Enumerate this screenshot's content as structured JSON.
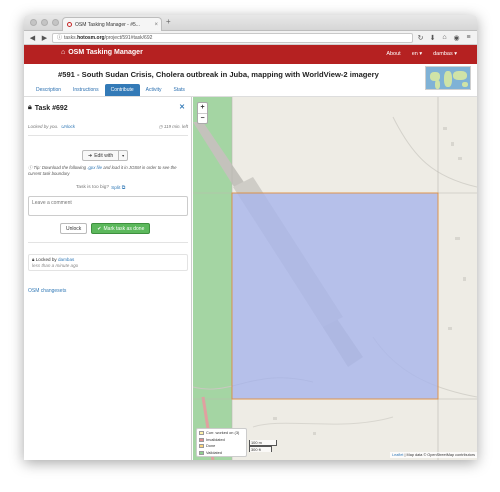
{
  "browser": {
    "tab_title": "OSM Tasking Manager - #5...",
    "url_prefix": "tasks.",
    "url_domain": "hotosm.org",
    "url_path": "/project/591#task/692"
  },
  "header": {
    "brand": "OSM Tasking Manager",
    "about": "About",
    "language": "en",
    "user": "dambas"
  },
  "project": {
    "title": "#591 - South Sudan Crisis, Cholera outbreak in Juba, mapping with WorldView-2 imagery",
    "tabs": [
      "Description",
      "Instructions",
      "Contribute",
      "Activity",
      "Stats"
    ],
    "active_tab": "Contribute"
  },
  "task": {
    "heading": "Task #692",
    "locked_text": "Locked by you.",
    "unlock_link": "Unlock",
    "time_left": "119 min. left",
    "edit_with": "Edit with",
    "tip_prefix": "Tip: Download the following",
    "tip_link": ".gpx file",
    "tip_suffix": "and load it in JOSM in order to see the current task boundary",
    "too_big": "Task is too big?",
    "split": "Split",
    "comment_placeholder": "Leave a comment",
    "unlock_button": "Unlock",
    "done_button": "Mark task as done",
    "history_prefix": "Locked by",
    "history_user": "dambas",
    "history_time": "less than a minute ago",
    "changesets": "OSM changesets"
  },
  "map": {
    "zoom_in": "+",
    "zoom_out": "−",
    "legend": [
      {
        "label": "Curr. worked on (3)",
        "color": "#fff3a8"
      },
      {
        "label": "Invalidated",
        "color": "#e08f8f"
      },
      {
        "label": "Done",
        "color": "#fbd57e"
      },
      {
        "label": "Validated",
        "color": "#8fd18f"
      }
    ],
    "scale_metric": "100 m",
    "scale_imperial": "300 ft",
    "attribution_link": "Leaflet",
    "attribution_text": "| Map data © OpenStreetMap contributors"
  },
  "colors": {
    "header_red": "#b52121",
    "accent_blue": "#337ab7",
    "task_fill": "#a9b6ec",
    "task_border": "#e0852f",
    "validated_green": "#8fd18f"
  }
}
